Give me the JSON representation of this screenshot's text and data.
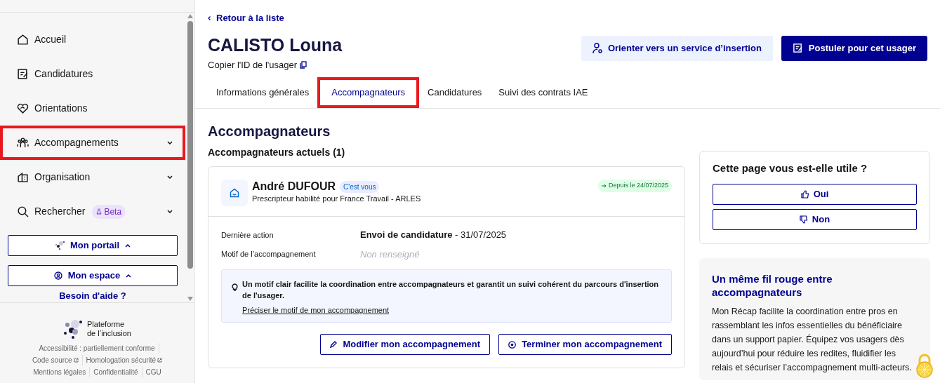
{
  "sidebar": {
    "nav": [
      {
        "kind": "home",
        "label": "Accueil",
        "has_caret": false,
        "highlighted": false
      },
      {
        "kind": "edit",
        "label": "Candidatures",
        "has_caret": false,
        "highlighted": false
      },
      {
        "kind": "heart",
        "label": "Orientations",
        "has_caret": false,
        "highlighted": false
      },
      {
        "kind": "people",
        "label": "Accompagnements",
        "has_caret": true,
        "highlighted": true
      },
      {
        "kind": "building",
        "label": "Organisation",
        "has_caret": true,
        "highlighted": false
      },
      {
        "kind": "search",
        "label": "Rechercher",
        "badge": "Beta",
        "has_caret": true,
        "highlighted": false
      }
    ],
    "buttons": [
      {
        "kind": "portal",
        "label": "Mon portail"
      },
      {
        "kind": "account",
        "label": "Mon espace"
      }
    ],
    "help": "Besoin d'aide ?",
    "logo_text": [
      "Plateforme",
      "de l’inclusion"
    ],
    "footer_links": [
      [
        "Accessibilité : partiellement conforme"
      ],
      [
        "Code source",
        "Homologation sécurité"
      ],
      [
        "Mentions légales",
        "Confidentialité",
        "CGU"
      ]
    ]
  },
  "back_link": "Retour à la liste",
  "person": {
    "name": "CALISTO Louna",
    "copy_id": "Copier l'ID de l'usager"
  },
  "actions": [
    {
      "kind": "secondary",
      "label": "Orienter vers un service d’insertion"
    },
    {
      "kind": "primary",
      "label": "Postuler pour cet usager"
    }
  ],
  "tabs": [
    {
      "label": "Informations générales",
      "selected": false,
      "highlighted": false
    },
    {
      "label": "Accompagnateurs",
      "selected": true,
      "highlighted": true
    },
    {
      "label": "Candidatures",
      "selected": false,
      "highlighted": false
    },
    {
      "label": "Suivi des contrats IAE",
      "selected": false,
      "highlighted": false
    }
  ],
  "section": {
    "title": "Accompagnateurs",
    "subtitle": "Accompagnateurs actuels (1)",
    "card": {
      "name": "André DUFOUR",
      "you_badge": "C'est vous",
      "role": "Prescripteur habilité pour France Travail - ARLES",
      "since": "Depuis le 24/07/2025",
      "fields": [
        {
          "label": "Dernière action",
          "value": "**Envoi de candidature** - 31/07/2025",
          "empty": false
        },
        {
          "label": "Motif de l’accompagnement",
          "value": "Non renseigné",
          "empty": true
        }
      ],
      "tip": "Un motif clair facilite la coordination entre accompagnateurs et garantit un suivi cohérent du parcours d'insertion de l'usager.",
      "tip_link": "Préciser le motif de mon accompagnement",
      "buttons": [
        {
          "kind": "edit",
          "label": "Modifier mon accompagnement"
        },
        {
          "kind": "stop",
          "label": "Terminer mon accompagnement"
        }
      ]
    }
  },
  "feedback": {
    "question": "Cette page vous est-elle utile ?",
    "options": [
      {
        "kind": "up",
        "label": "Oui"
      },
      {
        "kind": "down",
        "label": "Non"
      }
    ]
  },
  "promo": {
    "title": "Un même fil rouge entre accompagnateurs",
    "text": "Mon Récap facilite la coordination entre pros en rassemblant les infos essentielles du bénéficiaire dans un support papier. Équipez vos usagers dès aujourd’hui pour réduire les redites, fluidifier les relais et sécuriser l’accompagnement multi-acteurs."
  }
}
